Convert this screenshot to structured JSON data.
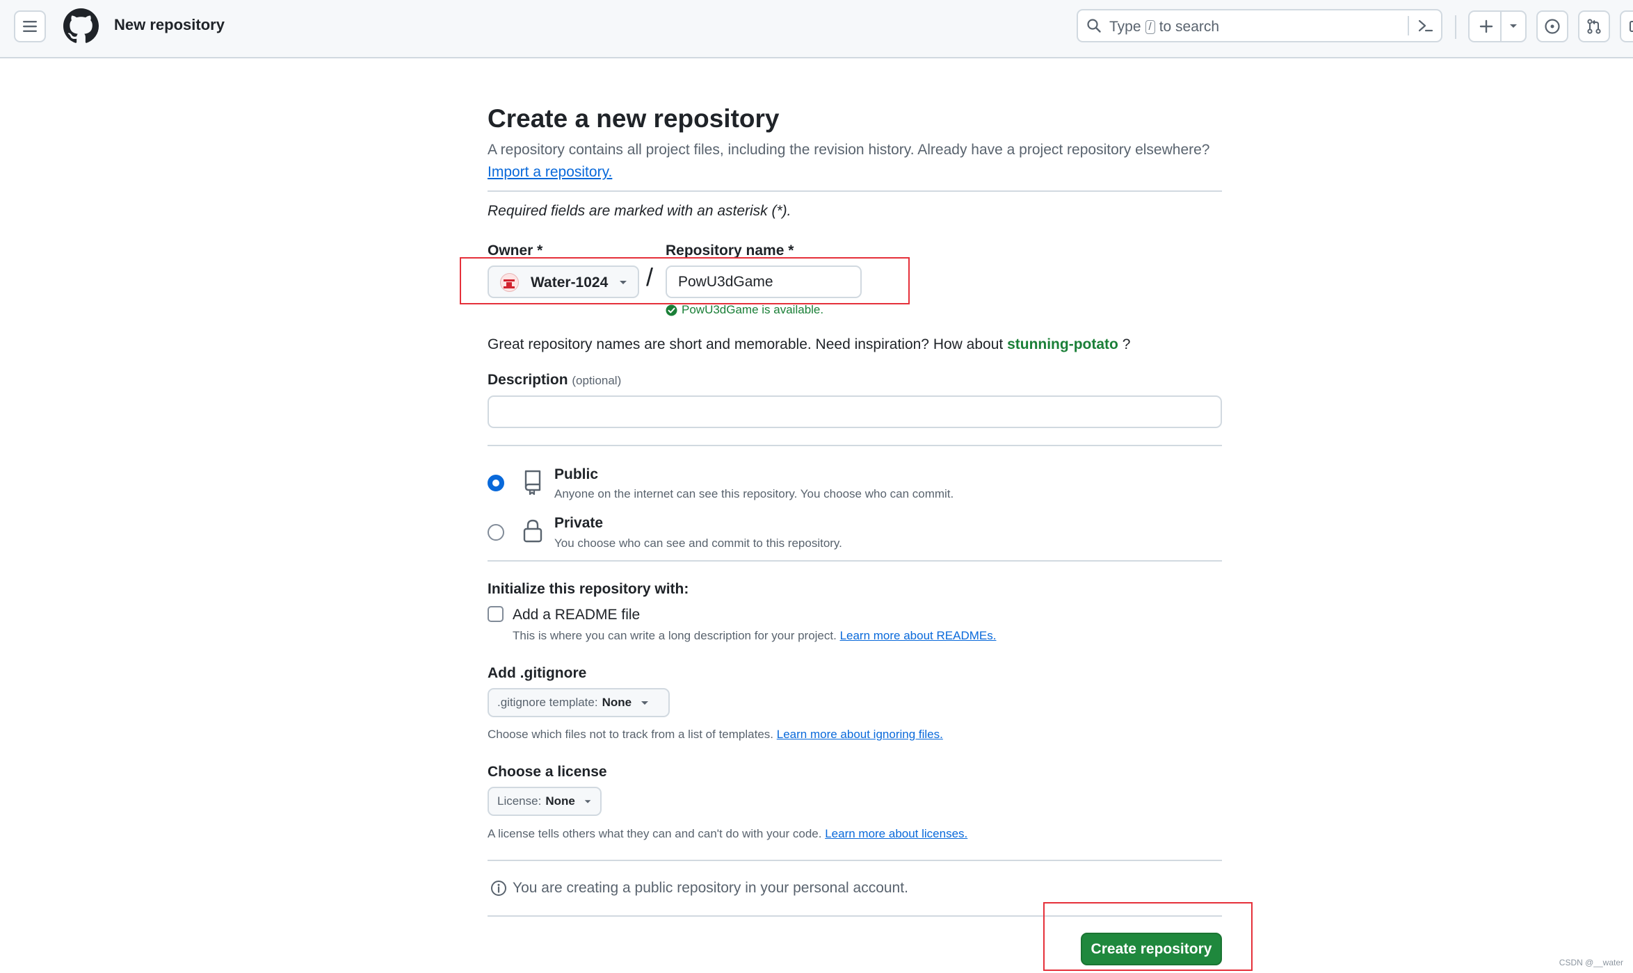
{
  "header": {
    "context_title": "New repository",
    "search": {
      "prefix": "Type",
      "key": "/",
      "suffix": "to search"
    },
    "icons": [
      "hamburger-icon",
      "github-logo",
      "search-icon",
      "terminal-icon",
      "plus-icon",
      "caret-down-icon",
      "issues-icon",
      "pull-requests-icon",
      "inbox-icon"
    ]
  },
  "page": {
    "title": "Create a new repository",
    "subtitle": "A repository contains all project files, including the revision history. Already have a project repository elsewhere?",
    "import_link": "Import a repository.",
    "required_note": "Required fields are marked with an asterisk (*)."
  },
  "owner": {
    "label": "Owner *",
    "value": "Water-1024"
  },
  "separator": "/",
  "repo_name": {
    "label": "Repository name *",
    "value": "PowU3dGame",
    "availability": "PowU3dGame is available."
  },
  "suggestion": {
    "prefix": "Great repository names are short and memorable. Need inspiration? How about",
    "name": "stunning-potato",
    "suffix": "?"
  },
  "description": {
    "label": "Description",
    "optional": "(optional)",
    "value": ""
  },
  "visibility": {
    "public": {
      "title": "Public",
      "desc": "Anyone on the internet can see this repository. You choose who can commit.",
      "selected": true
    },
    "private": {
      "title": "Private",
      "desc": "You choose who can see and commit to this repository.",
      "selected": false
    }
  },
  "init": {
    "heading": "Initialize this repository with:",
    "readme": {
      "label": "Add a README file",
      "checked": false,
      "help": "This is where you can write a long description for your project.",
      "link": "Learn more about READMEs."
    }
  },
  "gitignore": {
    "heading": "Add .gitignore",
    "button_prefix": ".gitignore template:",
    "button_value": "None",
    "help": "Choose which files not to track from a list of templates.",
    "link": "Learn more about ignoring files."
  },
  "license": {
    "heading": "Choose a license",
    "button_prefix": "License:",
    "button_value": "None",
    "help": "A license tells others what they can and can't do with your code.",
    "link": "Learn more about licenses."
  },
  "notice": "You are creating a public repository in your personal account.",
  "submit_label": "Create repository",
  "watermark": "CSDN @__water",
  "colors": {
    "primary_button": "#1f883d",
    "link": "#0969da",
    "success": "#1a7f37",
    "annotation": "#e5303a"
  }
}
